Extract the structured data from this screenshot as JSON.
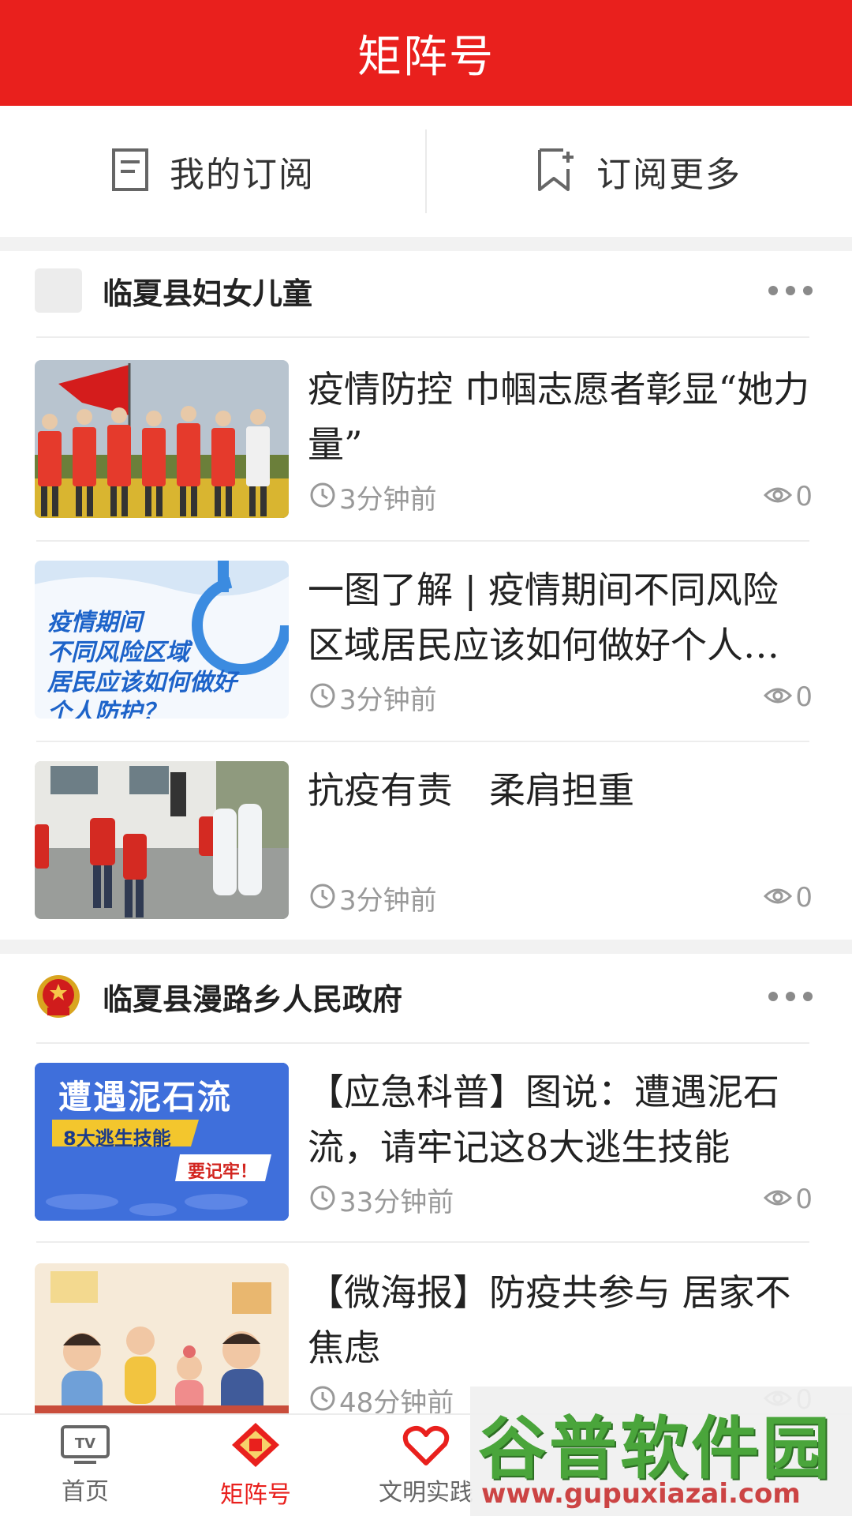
{
  "header": {
    "title": "矩阵号"
  },
  "subtabs": [
    {
      "label": "我的订阅",
      "icon": "subscription-list-icon"
    },
    {
      "label": "订阅更多",
      "icon": "bookmark-add-icon"
    }
  ],
  "sections": [
    {
      "name": "临夏县妇女儿童",
      "avatar": "blank-avatar",
      "articles": [
        {
          "title": "疫情防控 巾帼志愿者彰显“她力量”",
          "time": "3分钟前",
          "views": "0",
          "thumb": "volunteers-with-red-flag-photo"
        },
        {
          "title": "一图了解 | 疫情期间不同风险区域居民应该如何做好个人防护？",
          "time": "3分钟前",
          "views": "0",
          "thumb": "infographic-thumbnail",
          "thumb_text": [
            "疫情期间",
            "不同风险区域",
            "居民应该如何做好",
            "个人防护？"
          ]
        },
        {
          "title": "抗疫有责　柔肩担重",
          "time": "3分钟前",
          "views": "0",
          "thumb": "volunteers-in-protective-suits-photo"
        }
      ]
    },
    {
      "name": "临夏县漫路乡人民政府",
      "avatar": "national-emblem-icon",
      "articles": [
        {
          "title": "【应急科普】图说：遭遇泥石流，请牢记这8大逃生技能",
          "time": "33分钟前",
          "views": "0",
          "thumb": "mudslide-poster-thumbnail",
          "thumb_text": [
            "遭遇泥石流",
            "8大逃生技能",
            "要记牢！"
          ]
        },
        {
          "title": "【微海报】防疫共参与 居家不焦虑",
          "time": "48分钟前",
          "views": "0",
          "thumb": "family-at-home-illustration"
        }
      ]
    }
  ],
  "tabbar": [
    {
      "label": "首页",
      "icon": "tv-icon",
      "active": false
    },
    {
      "label": "矩阵号",
      "icon": "matrix-badge-icon",
      "active": true
    },
    {
      "label": "文明实践",
      "icon": "heart-icon",
      "active": false
    }
  ],
  "watermark": {
    "logo": "谷普软件园",
    "url": "www.gupuxiazai.com"
  },
  "colors": {
    "brand_red": "#e9201d",
    "meta_gray": "#999999",
    "divider": "#ededed"
  }
}
